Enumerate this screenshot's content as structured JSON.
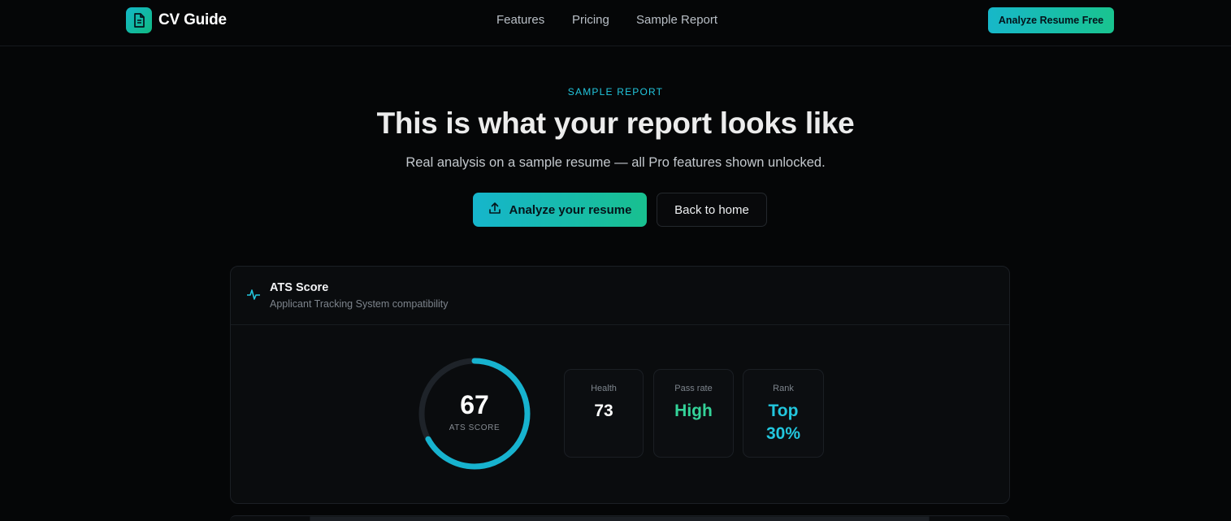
{
  "header": {
    "brand": "CV Guide",
    "nav": [
      "Features",
      "Pricing",
      "Sample Report"
    ],
    "cta": "Analyze Resume Free"
  },
  "hero": {
    "eyebrow": "SAMPLE REPORT",
    "title": "This is what your report looks like",
    "subtitle": "Real analysis on a sample resume — all Pro features shown unlocked.",
    "primary_button": "Analyze your resume",
    "secondary_button": "Back to home"
  },
  "ats_card": {
    "title": "ATS Score",
    "subtitle": "Applicant Tracking System compatibility",
    "score": "67",
    "score_fraction": 0.67,
    "score_label": "ATS SCORE",
    "stats": [
      {
        "label": "Health",
        "value": "73",
        "color": "#ffffff"
      },
      {
        "label": "Pass rate",
        "value": "High",
        "color": "#34d399"
      },
      {
        "label": "Rank",
        "value": "Top 30%",
        "color": "#22c6dd"
      }
    ]
  },
  "colors": {
    "accent_cyan": "#22c6dd",
    "accent_green": "#34d399",
    "background": "#050607"
  },
  "icons": {
    "brand": "document-icon",
    "upload": "upload-icon",
    "ats": "activity-pulse-icon"
  }
}
